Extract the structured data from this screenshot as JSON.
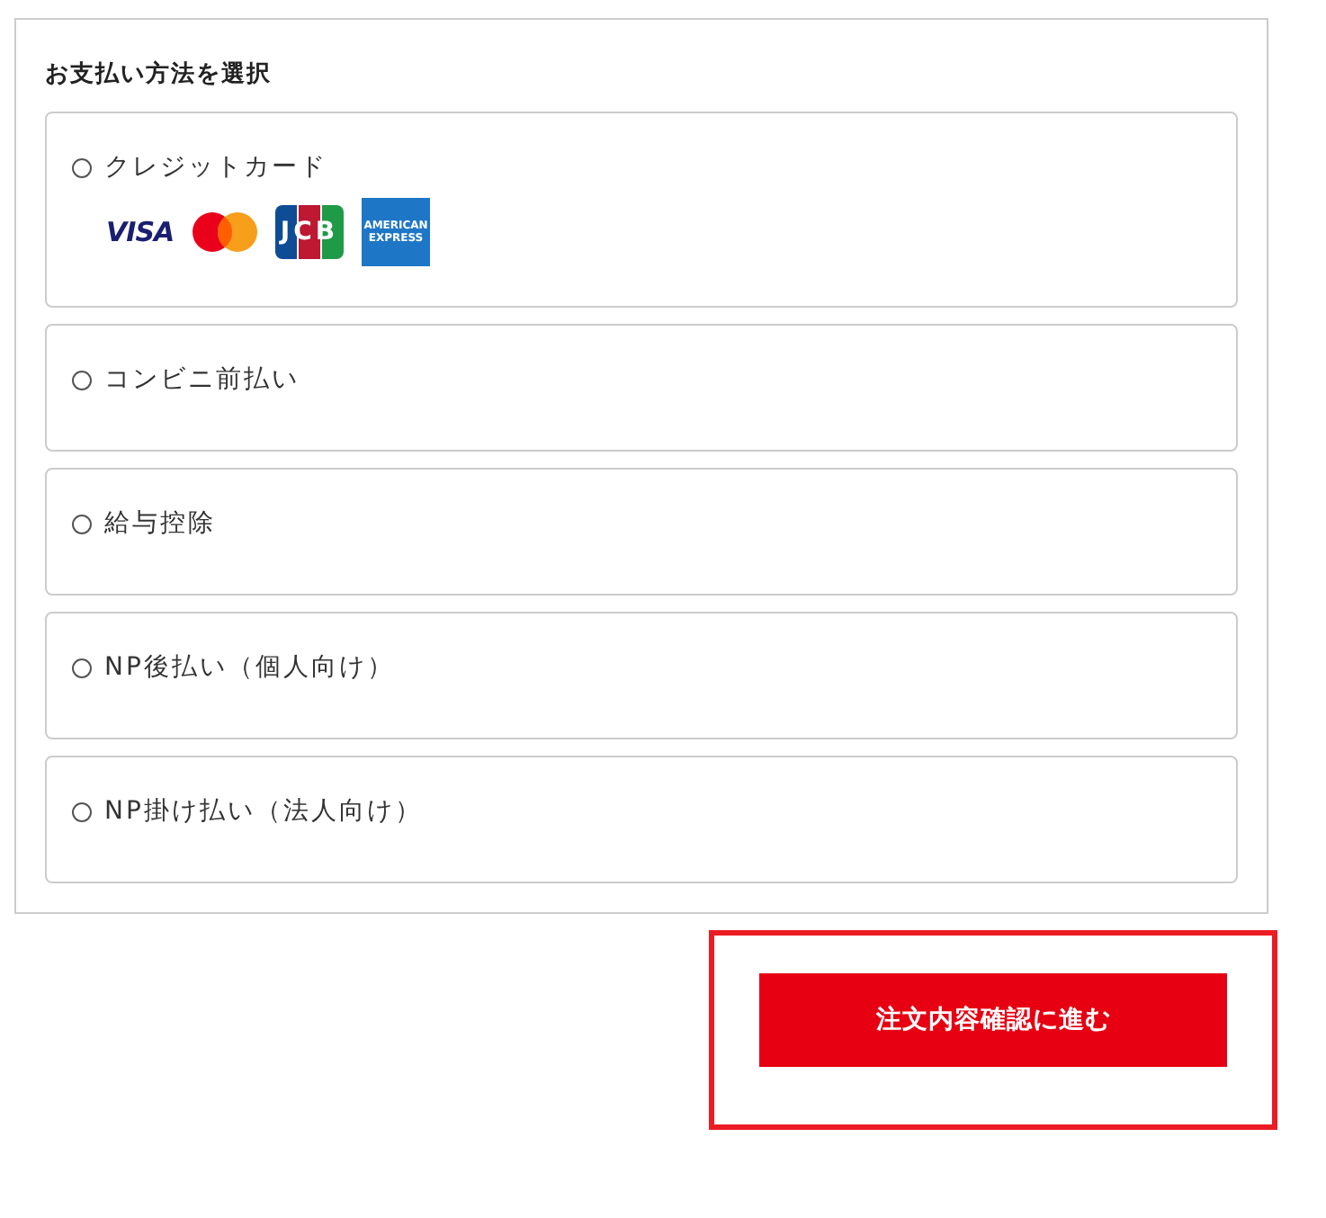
{
  "payment": {
    "title": "お支払い方法を選択",
    "options": [
      {
        "label": "クレジットカード",
        "selected": false,
        "logos": [
          {
            "kind": "visa",
            "text": "VISA"
          },
          {
            "kind": "mastercard"
          },
          {
            "kind": "jcb",
            "text": "JCB"
          },
          {
            "kind": "amex",
            "text": "AMERICAN EXPRESS"
          }
        ]
      },
      {
        "label": "コンビニ前払い",
        "selected": false
      },
      {
        "label": "給与控除",
        "selected": false
      },
      {
        "label": "NP後払い（個人向け）",
        "selected": false
      },
      {
        "label": "NP掛け払い（法人向け）",
        "selected": false
      }
    ]
  },
  "submit_button": {
    "label": "注文内容確認に進む",
    "highlighted": true
  }
}
